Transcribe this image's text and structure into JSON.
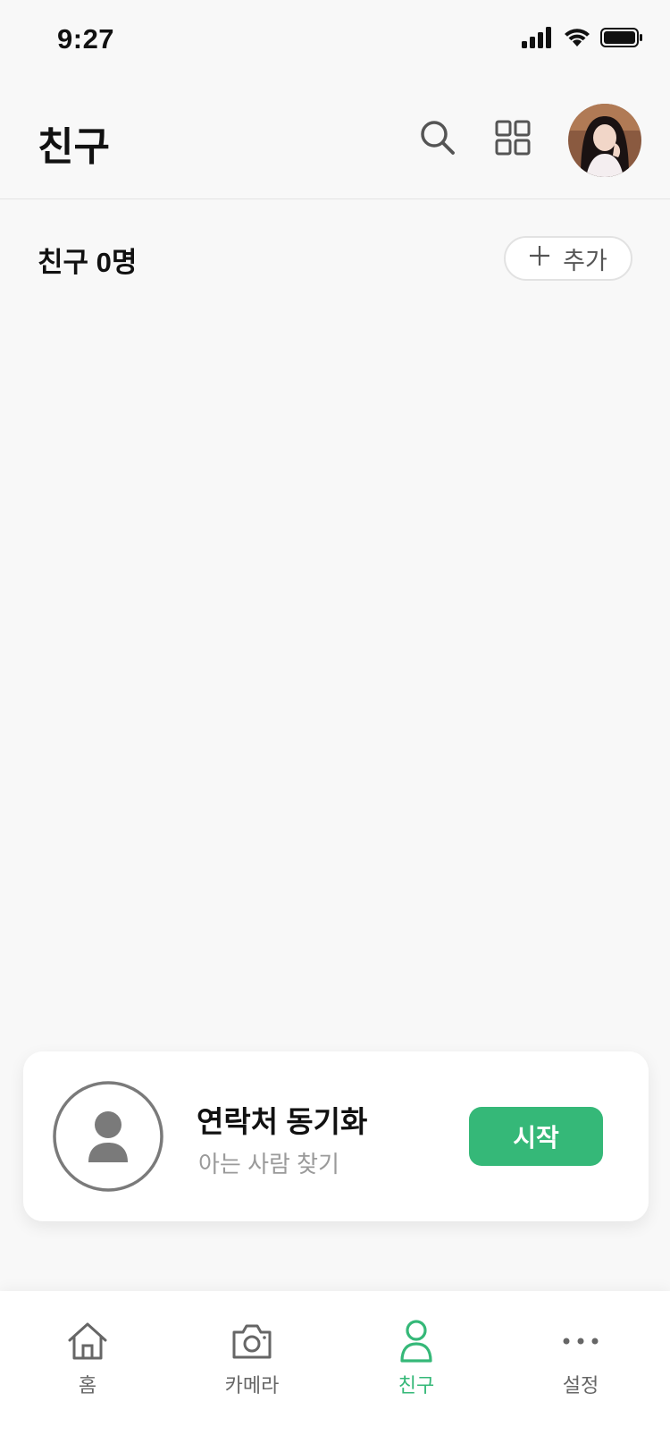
{
  "status_bar": {
    "time": "9:27"
  },
  "header": {
    "title": "친구"
  },
  "friends": {
    "title": "친구 0명",
    "add_label": "추가"
  },
  "sync_card": {
    "title": "연락처 동기화",
    "subtitle": "아는 사람 찾기",
    "button_label": "시작"
  },
  "tabs": [
    {
      "label": "홈",
      "icon": "home-icon"
    },
    {
      "label": "카메라",
      "icon": "camera-icon"
    },
    {
      "label": "친구",
      "icon": "person-icon",
      "active": true
    },
    {
      "label": "설정",
      "icon": "more-dots-icon"
    }
  ],
  "colors": {
    "accent": "#35b878",
    "background": "#f8f8f8",
    "muted_text": "#9a9a9a"
  }
}
